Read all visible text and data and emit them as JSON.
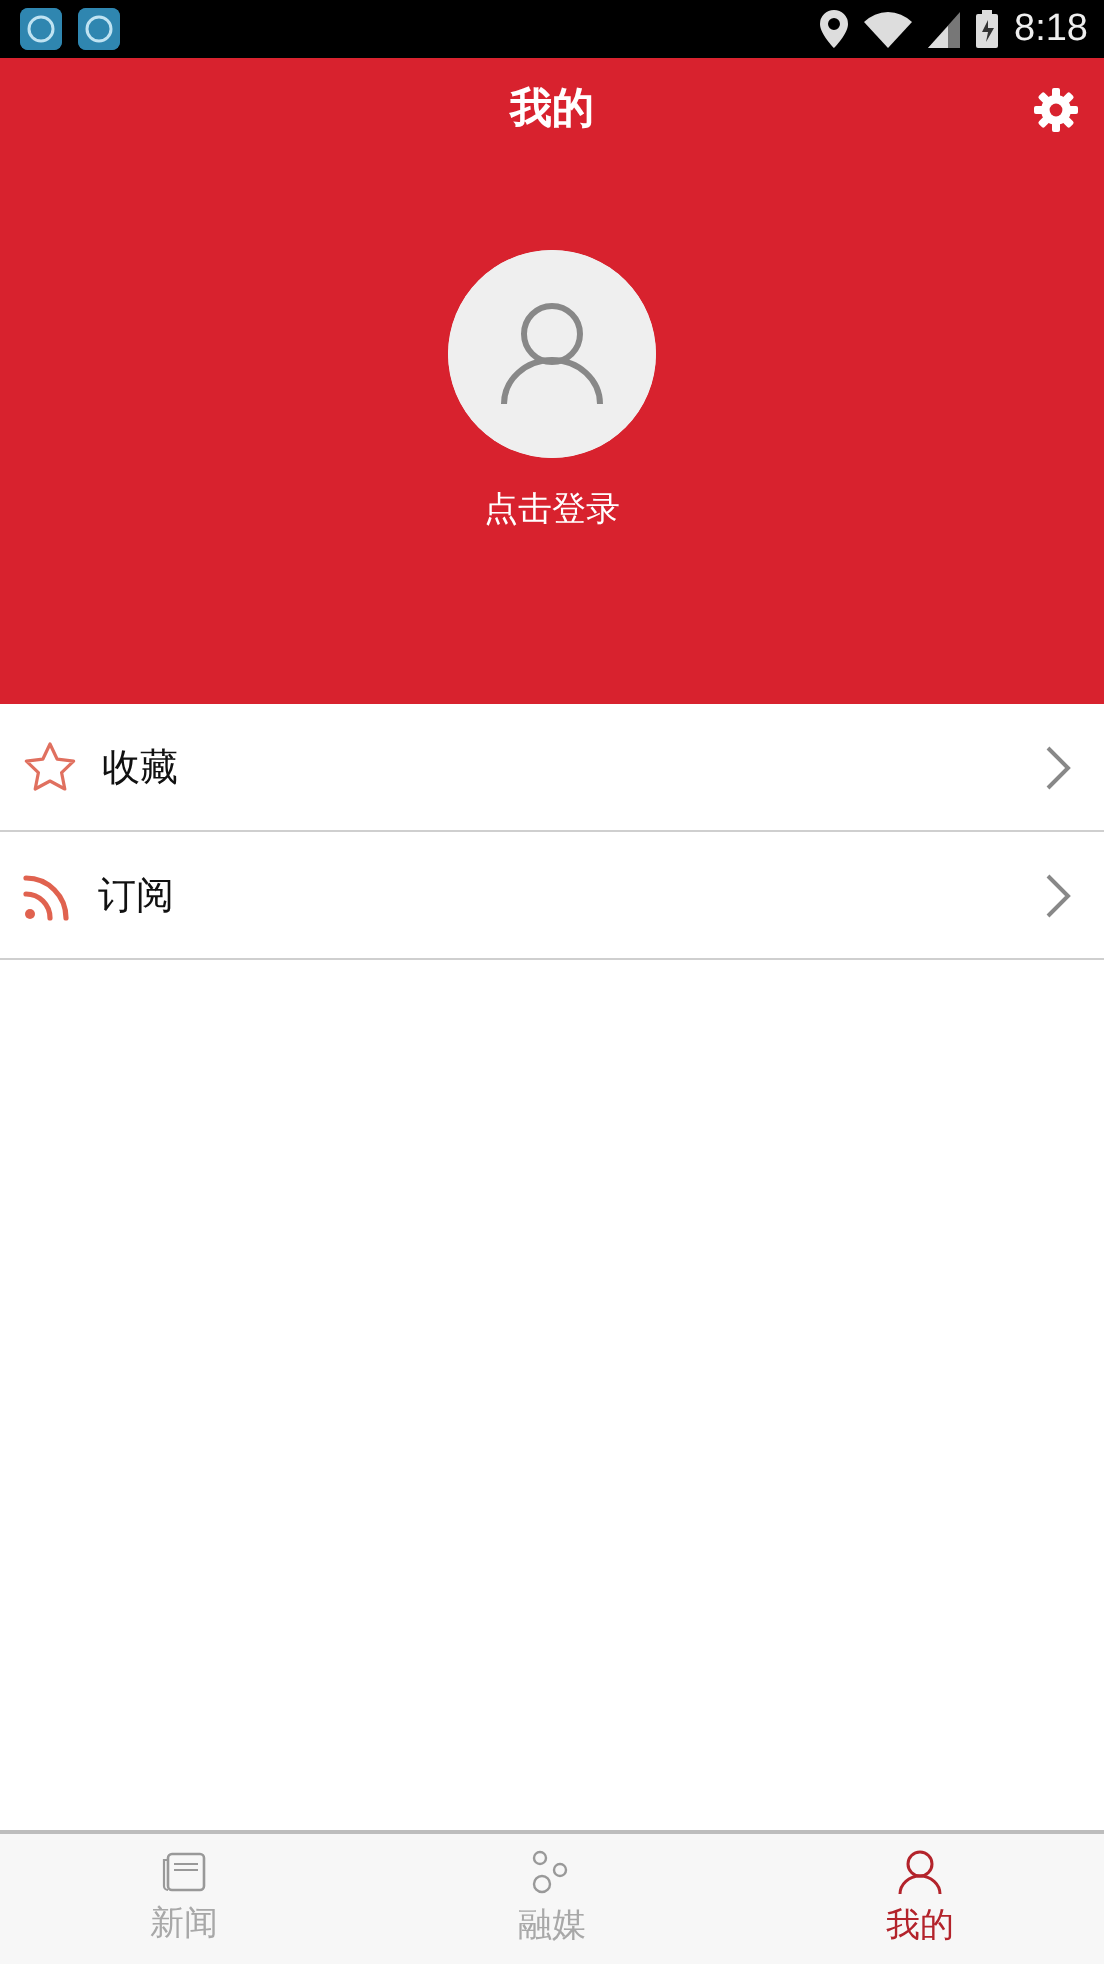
{
  "status_bar": {
    "time": "8:18"
  },
  "header": {
    "title": "我的"
  },
  "profile": {
    "login_label": "点击登录"
  },
  "menu": [
    {
      "kind": "favorites",
      "label": "收藏"
    },
    {
      "kind": "subscriptions",
      "label": "订阅"
    }
  ],
  "tabs": [
    {
      "kind": "news",
      "label": "新闻",
      "selected": false
    },
    {
      "kind": "media",
      "label": "融媒",
      "selected": false
    },
    {
      "kind": "mine",
      "label": "我的",
      "selected": true
    }
  ]
}
